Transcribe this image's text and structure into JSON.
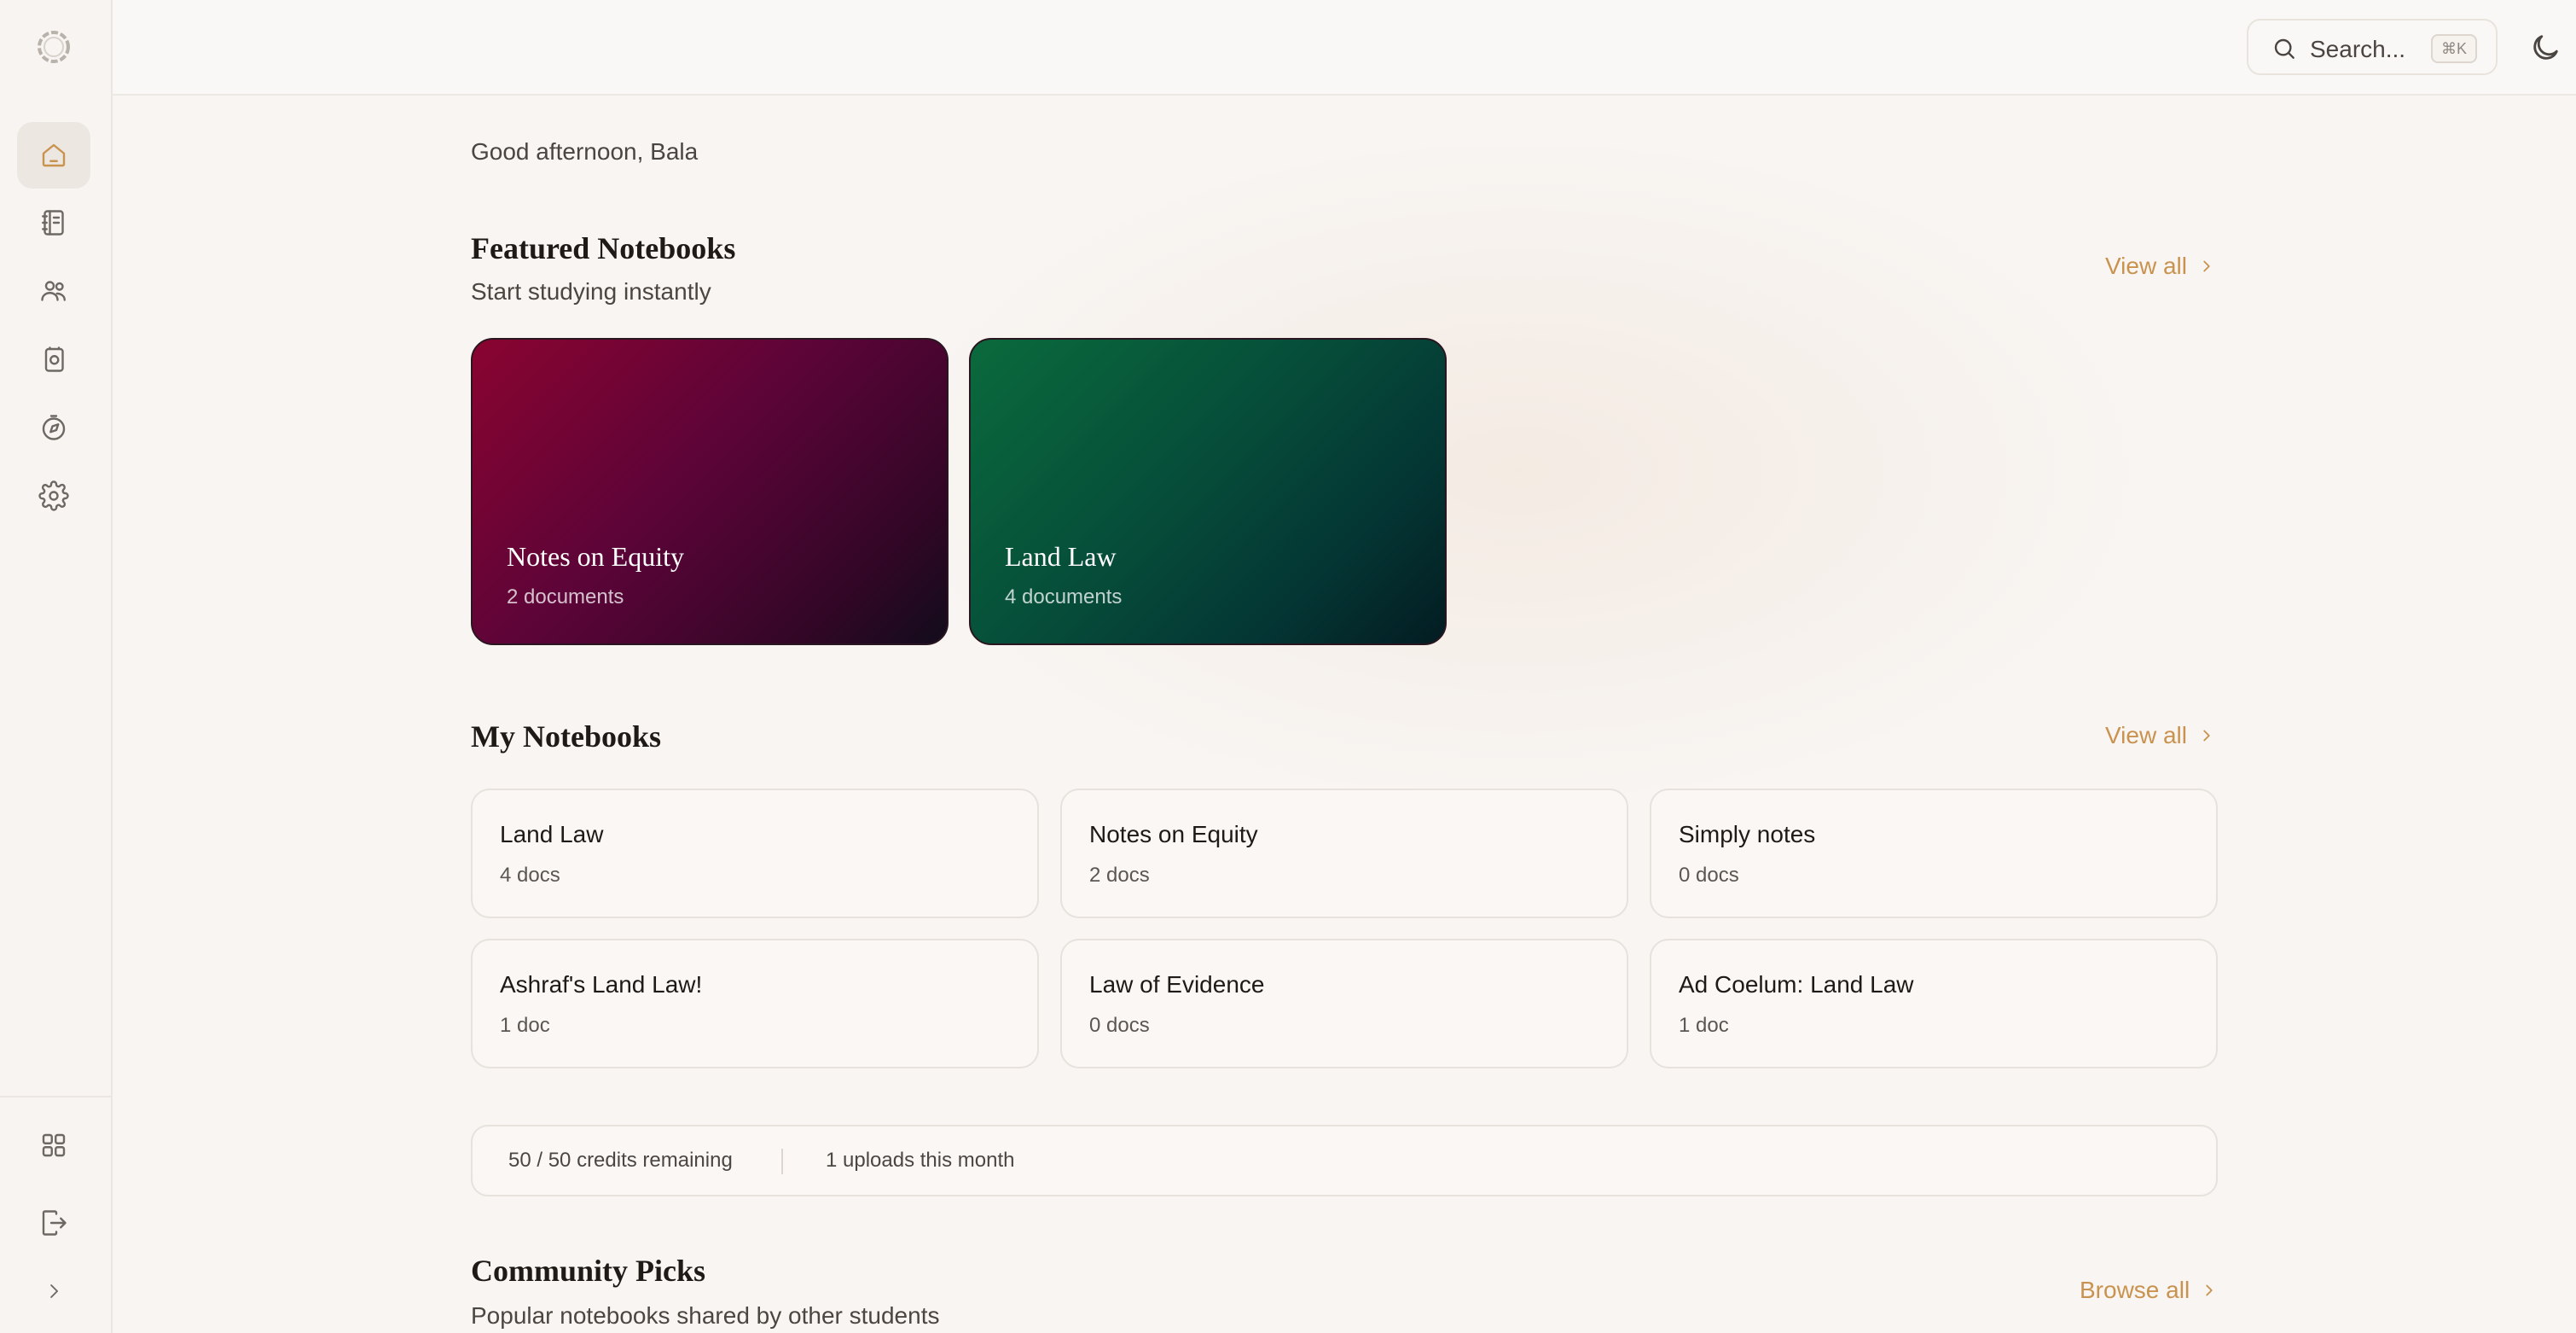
{
  "sidebar": {
    "items": [
      {
        "icon": "home-icon",
        "active": true
      },
      {
        "icon": "notebook-icon",
        "active": false
      },
      {
        "icon": "users-icon",
        "active": false
      },
      {
        "icon": "flashcards-icon",
        "active": false
      },
      {
        "icon": "compass-icon",
        "active": false
      },
      {
        "icon": "gear-icon",
        "active": false
      }
    ],
    "bottom_items": [
      {
        "icon": "grid-icon"
      },
      {
        "icon": "logout-icon"
      },
      {
        "icon": "chevron-right-icon"
      }
    ]
  },
  "header": {
    "search_placeholder": "Search...",
    "search_shortcut": "⌘K"
  },
  "greeting": "Good afternoon, Bala",
  "featured": {
    "title": "Featured Notebooks",
    "subtitle": "Start studying instantly",
    "view_all": "View all",
    "cards": [
      {
        "title": "Notes on Equity",
        "subtitle": "2 documents"
      },
      {
        "title": "Land Law",
        "subtitle": "4 documents"
      }
    ]
  },
  "my_notebooks": {
    "title": "My Notebooks",
    "view_all": "View all",
    "cards": [
      {
        "title": "Land Law",
        "subtitle": "4 docs"
      },
      {
        "title": "Notes on Equity",
        "subtitle": "2 docs"
      },
      {
        "title": "Simply notes",
        "subtitle": "0 docs"
      },
      {
        "title": "Ashraf's Land Law!",
        "subtitle": "1 doc"
      },
      {
        "title": "Law of Evidence",
        "subtitle": "0 docs"
      },
      {
        "title": "Ad Coelum: Land Law",
        "subtitle": "1 doc"
      }
    ]
  },
  "usage": {
    "credits": "50 / 50 credits remaining",
    "uploads": "1 uploads this month"
  },
  "community": {
    "title": "Community Picks",
    "subtitle": "Popular notebooks shared by other students",
    "browse_all": "Browse all"
  },
  "colors": {
    "accent": "#c9934f",
    "background": "#f8f5f2"
  }
}
